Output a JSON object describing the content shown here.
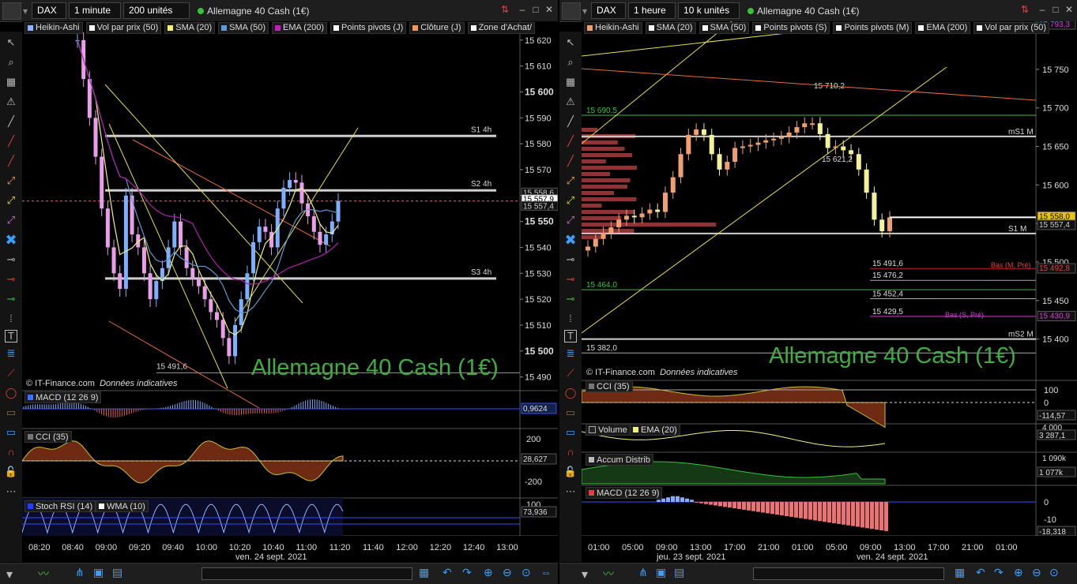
{
  "left": {
    "symbol": "DAX",
    "interval": "1 minute",
    "units": "200 unités",
    "instrument": "Allemagne 40 Cash (1€)",
    "legend": [
      {
        "label": "Heikin-Ashi",
        "color": "#8fb4ff"
      },
      {
        "label": "Vol par prix (50)",
        "color": "#ffffff"
      },
      {
        "label": "SMA (20)",
        "color": "#f2f27a"
      },
      {
        "label": "SMA (50)",
        "color": "#5b9bd5"
      },
      {
        "label": "EMA (200)",
        "color": "#c020c0"
      },
      {
        "label": "Points pivots (J)",
        "color": "#ffffff"
      },
      {
        "label": "Clôture (J)",
        "color": "#f29a5a"
      },
      {
        "label": "Zone d'Achat/",
        "color": "#ffffff"
      }
    ],
    "copyright": "© IT-Finance.com",
    "disclaimer": "Données indicatives",
    "watermark": "Allemagne 40 Cash (1€)",
    "date_label": "ven. 24 sept. 2021",
    "macd_label": "MACD (12 26 9)",
    "macd_value": "0,9624",
    "cci_label": "CCI (35)",
    "cci_value": "28,627",
    "cci_ticks": [
      "200",
      "-200"
    ],
    "stoch_label": "Stoch RSI (14)",
    "wma_label": "WMA (10)",
    "stoch_value": "73,936",
    "stoch_tick": "100",
    "price_badges": [
      "15 558,6",
      "15 557,9",
      "15 557,4"
    ]
  },
  "right": {
    "symbol": "DAX",
    "interval": "1 heure",
    "units": "10 k unités",
    "instrument": "Allemagne 40 Cash (1€)",
    "legend": [
      {
        "label": "Heikin-Ashi",
        "color": "#f0a070"
      },
      {
        "label": "SMA (20)",
        "color": "#ffffff"
      },
      {
        "label": "SMA (50)",
        "color": "#ffffff"
      },
      {
        "label": "Points pivots (S)",
        "color": "#ffffff"
      },
      {
        "label": "Points pivots (M)",
        "color": "#ffffff"
      },
      {
        "label": "EMA (200)",
        "color": "#ffffff"
      },
      {
        "label": "Vol par prix (50)",
        "color": "#ffffff"
      }
    ],
    "copyright": "© IT-Finance.com",
    "disclaimer": "Données indicatives",
    "watermark": "Allemagne 40 Cash (1€)",
    "date_label_1": "jeu. 23 sept. 2021",
    "date_label_2": "ven. 24 sept. 2021",
    "cci_label": "CCI (35)",
    "cci_ticks": [
      "100",
      "0"
    ],
    "cci_value": "-114,57",
    "volume_label": "Volume",
    "volume_ema_label": "EMA (20)",
    "volume_value": "3 287,1",
    "volume_tick": "4 000",
    "accum_label": "Accum Distrib",
    "accum_ticks": [
      "1 090k",
      "1 077k"
    ],
    "macd_label": "MACD (12 26 9)",
    "macd_ticks": [
      "0",
      "-10"
    ],
    "macd_value": "-18,318",
    "price_badges": [
      "15 793,3",
      "15 558,0",
      "15 557,4",
      "15 492,8",
      "15 430,9"
    ]
  },
  "chart_data": [
    {
      "type": "candlestick",
      "title": "DAX — 1 minute",
      "x_tick_labels": [
        "08:20",
        "08:40",
        "09:00",
        "09:20",
        "09:40",
        "10:00",
        "10:20",
        "10:40",
        "11:00",
        "11:20",
        "11:40",
        "12:00",
        "12:20",
        "12:40",
        "13:00"
      ],
      "y_tick_labels": [
        15620,
        15610,
        15600,
        15590,
        15580,
        15570,
        15560,
        15550,
        15540,
        15530,
        15520,
        15510,
        15500,
        15490
      ],
      "ylim": [
        15485,
        15623
      ],
      "closes": [
        15620,
        15605,
        15590,
        15575,
        15555,
        15540,
        15530,
        15524,
        15560,
        15545,
        15540,
        15530,
        15520,
        15527,
        15532,
        15540,
        15550,
        15540,
        15532,
        15528,
        15525,
        15520,
        15515,
        15512,
        15505,
        15498,
        15510,
        15520,
        15530,
        15542,
        15548,
        15546,
        15540,
        15555,
        15563,
        15566,
        15565,
        15557,
        15552,
        15546,
        15541,
        15545,
        15550,
        15557.9
      ],
      "levels": [
        {
          "label": "S1 4h",
          "value": 15583
        },
        {
          "label": "S2 4h",
          "value": 15562
        },
        {
          "label": "S3 4h",
          "value": 15528
        },
        {
          "label": "15 491,6",
          "value": 15491.6
        }
      ]
    },
    {
      "type": "candlestick",
      "title": "DAX — 1 heure",
      "x_tick_labels": [
        "01:00",
        "05:00",
        "09:00",
        "13:00",
        "17:00",
        "21:00",
        "01:00",
        "05:00",
        "09:00",
        "13:00",
        "17:00",
        "21:00",
        "01:00"
      ],
      "y_tick_labels": [
        15750,
        15700,
        15650,
        15600,
        15550,
        15500,
        15450,
        15400
      ],
      "ylim": [
        15372,
        15798
      ],
      "closes": [
        15520,
        15530,
        15538,
        15545,
        15555,
        15560,
        15558,
        15563,
        15568,
        15565,
        15590,
        15610,
        15640,
        15665,
        15672,
        15665,
        15640,
        15620,
        15630,
        15648,
        15650,
        15652,
        15655,
        15658,
        15660,
        15662,
        15668,
        15675,
        15680,
        15680,
        15666,
        15648,
        15650,
        15645,
        15640,
        15620,
        15590,
        15555,
        15540,
        15558
      ],
      "levels": [
        {
          "label": "15 690,5",
          "value": 15690.5
        },
        {
          "label": "mS1 M",
          "value": 15663
        },
        {
          "label": "S1 M",
          "value": 15537
        },
        {
          "label": "15 491,6",
          "value": 15491.6
        },
        {
          "label": "15 476,2",
          "value": 15476.2
        },
        {
          "label": "15 464,0",
          "value": 15464.0
        },
        {
          "label": "15 452,4",
          "value": 15452.4
        },
        {
          "label": "15 429,5",
          "value": 15429.5
        },
        {
          "label": "mS2 M",
          "value": 15400
        },
        {
          "label": "15 382,0",
          "value": 15382.0
        }
      ],
      "annotations": [
        "15 710,2",
        "15 621,2",
        "Bas (M, Pré)",
        "Bas (S, Pré)"
      ]
    }
  ]
}
